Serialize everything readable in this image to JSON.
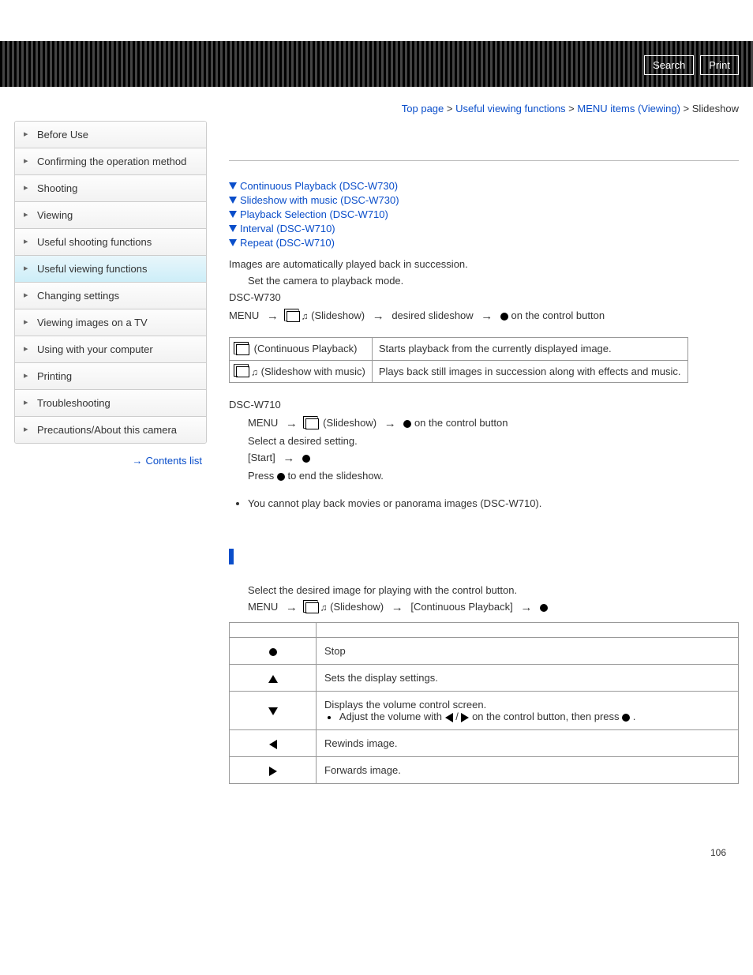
{
  "header": {
    "search": "Search",
    "print": "Print"
  },
  "breadcrumb": {
    "top": "Top page",
    "b1": "Useful viewing functions",
    "b2": "MENU items (Viewing)",
    "current": "Slideshow",
    "sep": " > "
  },
  "sidebar": {
    "items": [
      {
        "label": "Before Use"
      },
      {
        "label": "Confirming the operation method"
      },
      {
        "label": "Shooting"
      },
      {
        "label": "Viewing"
      },
      {
        "label": "Useful shooting functions"
      },
      {
        "label": "Useful viewing functions"
      },
      {
        "label": "Changing settings"
      },
      {
        "label": "Viewing images on a TV"
      },
      {
        "label": "Using with your computer"
      },
      {
        "label": "Printing"
      },
      {
        "label": "Troubleshooting"
      },
      {
        "label": "Precautions/About this camera"
      }
    ],
    "contents_list": "Contents list"
  },
  "main": {
    "anchors": [
      "Continuous Playback (DSC-W730)",
      "Slideshow with music (DSC-W730)",
      "Playback Selection (DSC-W710)",
      "Interval (DSC-W710)",
      "Repeat (DSC-W710)"
    ],
    "intro": "Images are automatically played back in succession.",
    "step1": "Set the camera to playback mode.",
    "model730": "DSC-W730",
    "flow730": {
      "menu": "MENU",
      "slideshow": "(Slideshow)",
      "desired": "desired slideshow",
      "ctrl": "on the control button"
    },
    "table730": {
      "r1label": "(Continuous Playback)",
      "r1desc": "Starts playback from the currently displayed image.",
      "r2label": "(Slideshow with music)",
      "r2desc": "Plays back still images in succession along with effects and music."
    },
    "model710": "DSC-W710",
    "flow710": {
      "menu": "MENU",
      "slideshow": "(Slideshow)",
      "ctrl": "on the control button"
    },
    "step710b": "Select a desired setting.",
    "step710c": "[Start]",
    "step710d_a": "Press ",
    "step710d_b": " to end the slideshow.",
    "note1": "You cannot play back movies or panorama images (DSC-W710).",
    "cp_intro": "Select the desired image for playing with the control button.",
    "cp_flow": {
      "menu": "MENU",
      "slideshow": "(Slideshow)",
      "cp": "[Continuous Playback]"
    },
    "table_controls": {
      "rows": [
        {
          "icon": "dot",
          "desc": "Stop"
        },
        {
          "icon": "up",
          "desc": "Sets the display settings."
        },
        {
          "icon": "down",
          "desc_a": "Displays the volume control screen.",
          "desc_b_pre": "Adjust the volume with ",
          "desc_b_mid": " / ",
          "desc_b_post": " on the control button, then press ",
          "desc_b_end": "."
        },
        {
          "icon": "left",
          "desc": "Rewinds image."
        },
        {
          "icon": "right",
          "desc": "Forwards image."
        }
      ]
    }
  },
  "page_number": "106"
}
